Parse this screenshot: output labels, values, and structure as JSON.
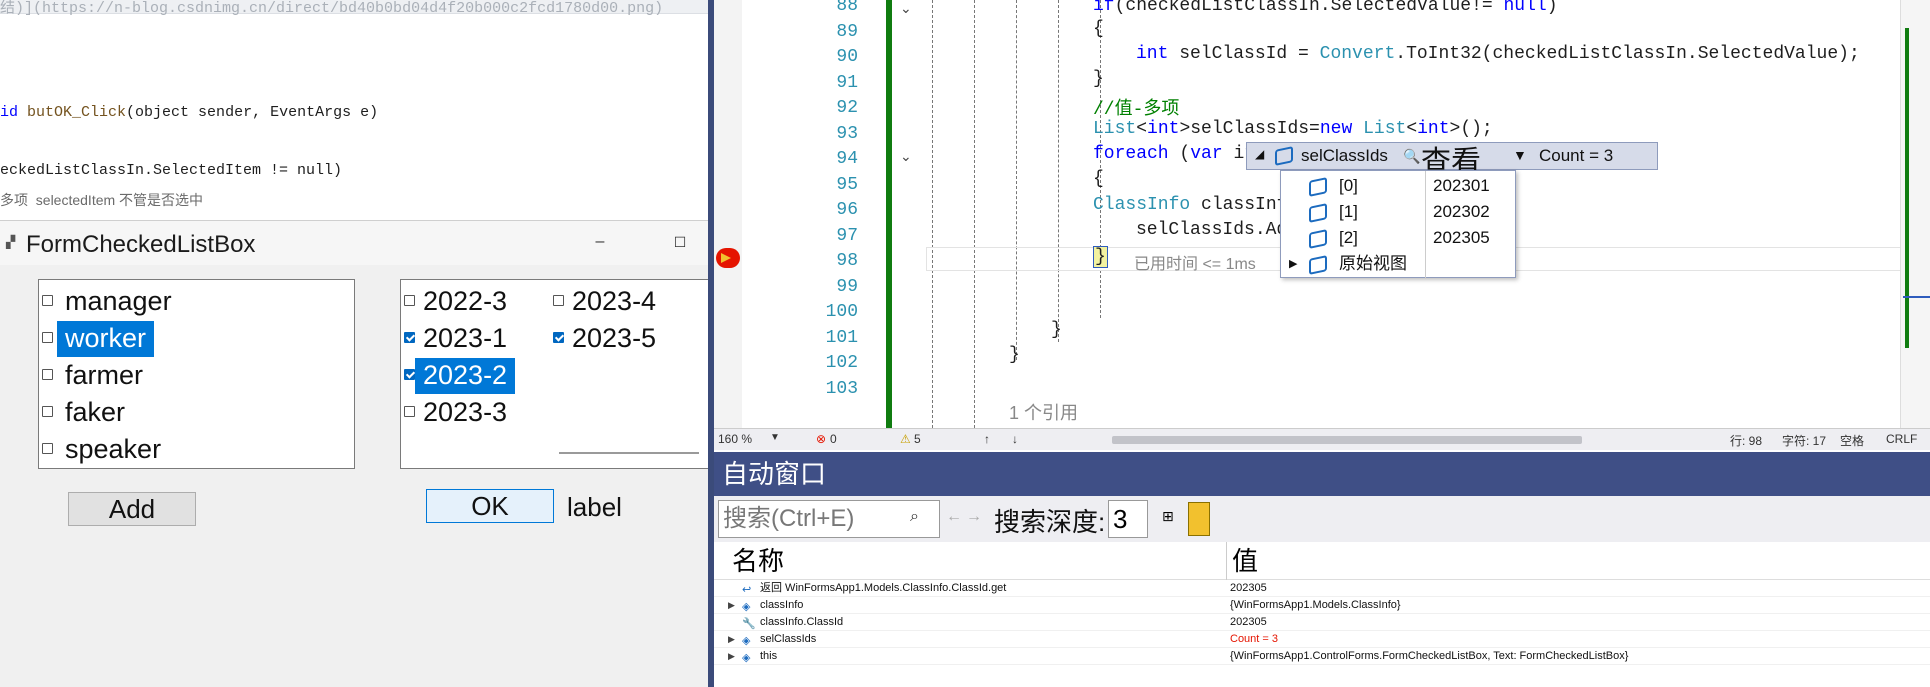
{
  "left_editor": {
    "url_fragment": "结)](https://n-blog.csdnimg.cn/direct/bd40b0bd04d4f20b000c2fcd1780d00.png)",
    "code_line1": {
      "prefix": "id ",
      "method": "butOK_Click",
      "rest": "(object sender, EventArgs e)"
    },
    "code_line2": "eckedListClassIn.SelectedItem != null)",
    "comment_line": "多项  selectedItem 不管是否选中"
  },
  "form": {
    "title": "FormCheckedListBox",
    "minimize": "–",
    "maximize": "☐",
    "list1": [
      {
        "label": "manager",
        "checked": false,
        "selected": false
      },
      {
        "label": "worker",
        "checked": false,
        "selected": true
      },
      {
        "label": "farmer",
        "checked": false,
        "selected": false
      },
      {
        "label": "faker",
        "checked": false,
        "selected": false
      },
      {
        "label": "speaker",
        "checked": false,
        "selected": false
      }
    ],
    "list2": [
      {
        "label": "2022-3",
        "checked": false,
        "selected": false
      },
      {
        "label": "2023-1",
        "checked": true,
        "selected": false
      },
      {
        "label": "2023-2",
        "checked": true,
        "selected": true
      },
      {
        "label": "2023-3",
        "checked": false,
        "selected": false
      },
      {
        "label": "2023-4",
        "checked": false,
        "selected": false
      },
      {
        "label": "2023-5",
        "checked": true,
        "selected": false
      }
    ],
    "add_button": "Add",
    "ok_button": "OK",
    "label": "label"
  },
  "editor": {
    "lines": [
      {
        "num": "88",
        "indent": 0,
        "html": "if(checkedListClassIn.SelectedValue!= null)"
      },
      {
        "num": "89",
        "text": "{"
      },
      {
        "num": "90",
        "text": "int selClassId = Convert.ToInt32(checkedListClassIn.SelectedValue);"
      },
      {
        "num": "91",
        "text": "}"
      },
      {
        "num": "92",
        "text": "//值-多项"
      },
      {
        "num": "93",
        "text": "List<int>selClassIds=new List<int>();"
      },
      {
        "num": "94",
        "text": "foreach (var it"
      },
      {
        "num": "95",
        "text": "{"
      },
      {
        "num": "96",
        "text": "ClassInfo classInf"
      },
      {
        "num": "97",
        "text": "selClassIds.Ad"
      },
      {
        "num": "98",
        "text": "}"
      },
      {
        "num": "99",
        "text": ""
      },
      {
        "num": "100",
        "text": ""
      },
      {
        "num": "101",
        "text": "}"
      },
      {
        "num": "102",
        "text": "}"
      },
      {
        "num": "103",
        "text": ""
      }
    ],
    "elapsed": "已用时间 <= 1ms",
    "references": "1 个引用",
    "datatip": {
      "name": "selClassIds",
      "view": "查看",
      "value": "Count = 3",
      "items": [
        {
          "index": "[0]",
          "value": "202301"
        },
        {
          "index": "[1]",
          "value": "202302"
        },
        {
          "index": "[2]",
          "value": "202305"
        }
      ],
      "raw_view": "原始视图"
    }
  },
  "statusbar": {
    "zoom": "160 %",
    "errors": "0",
    "warnings": "5",
    "line": "行: 98",
    "char": "字符: 17",
    "space": "空格",
    "eol": "CRLF"
  },
  "autos": {
    "title": "自动窗口",
    "search_placeholder": "搜索(Ctrl+E)",
    "depth_label": "搜索深度:",
    "depth_value": "3",
    "col_name": "名称",
    "col_value": "值",
    "rows": [
      {
        "name": "返回 WinFormsApp1.Models.ClassInfo.ClassId.get",
        "value": "202305",
        "expand": false,
        "icon": "return-icon"
      },
      {
        "name": "classInfo",
        "value": "{WinFormsApp1.Models.ClassInfo}",
        "expand": true,
        "icon": "object-icon"
      },
      {
        "name": "classInfo.ClassId",
        "value": "202305",
        "expand": false,
        "icon": "wrench-icon"
      },
      {
        "name": "selClassIds",
        "value": "Count = 3",
        "expand": true,
        "icon": "object-icon",
        "value_color": "#e51400"
      },
      {
        "name": "this",
        "value": "{WinFormsApp1.ControlForms.FormCheckedListBox, Text: FormCheckedListBox}",
        "expand": true,
        "icon": "object-icon"
      }
    ]
  },
  "colors": {
    "selection": "#0078d7",
    "change_bar": "#107c10",
    "autos_header": "#3f4f86",
    "breakpoint": "#e51400"
  }
}
